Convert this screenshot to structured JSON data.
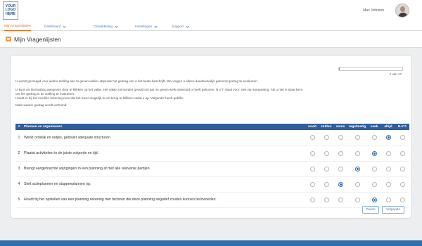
{
  "header": {
    "logo_text": "YOUR\nLOGO\nHERE",
    "user_name": "Max Johnson"
  },
  "nav": {
    "items": [
      {
        "label": "Mijn Vragenlijsten",
        "active": true,
        "has_menu": false
      },
      {
        "label": "Dashboard",
        "active": false,
        "has_menu": true
      },
      {
        "label": "Ontwikkeling",
        "active": false,
        "has_menu": true
      },
      {
        "label": "Instellingen",
        "active": false,
        "has_menu": true
      },
      {
        "label": "Support",
        "active": false,
        "has_menu": true
      }
    ]
  },
  "page": {
    "title": "Mijn Vragenlijsten"
  },
  "progress": {
    "value": 0.01,
    "label": "1 van 17"
  },
  "instructions": [
    "U wordt gevraagd voor iedere stelling aan te geven welke uitspraak het gedrag van u het beste beschrijft. We vragen u alleen daadwerkelijk getoond gedrag te evalueren.",
    "U kunt uw inschatting aangeven door te klikken op het vakje. Het vakje zal worden gevuld om aan te geven welk antwoord u heeft gekozen. N.V.T. staat voor: niet van toepassing. Als u niet in staat bent",
    "om het gedrag in de stelling te evalueren.",
    "Houdt er bij het invullen rekening mee dat het meer mogelijk is om terug te klikken nadat u op 'Volgende' heeft geklikt.",
    "Mate waarin gedrag wordt vertoond:"
  ],
  "table": {
    "number_header": "#",
    "section_header": "Plannen en organiseren",
    "options": [
      "nooit",
      "zelden",
      "soms",
      "regelmatig",
      "vaak",
      "altijd",
      "N.V.T."
    ],
    "questions": [
      {
        "number": "1",
        "text": "Werkt ordelijk en netjes, gebruikt adequate structuren.",
        "selected": 5
      },
      {
        "number": "2",
        "text": "Plaatst activiteiten in de juiste volgorde en tijd.",
        "selected": 4
      },
      {
        "number": "3",
        "text": "Brengt aangebrachte wijzigingen in een planning af met alle relevante partijen.",
        "selected": 3
      },
      {
        "number": "4",
        "text": "Stelt actieplannen en stappenplannen op.",
        "selected": 2
      },
      {
        "number": "5",
        "text": "Houdt bij het opstellen van een planning rekening met factoren die deze planning negatief zouden kunnen beïnvloeden.",
        "selected": 4
      }
    ]
  },
  "buttons": {
    "pause": "Pauze",
    "next": "Volgende"
  },
  "colors": {
    "accent": "#e06c22",
    "primary": "#2f5f9b",
    "link": "#4a7ab7",
    "footer": "#2e6fb0"
  }
}
